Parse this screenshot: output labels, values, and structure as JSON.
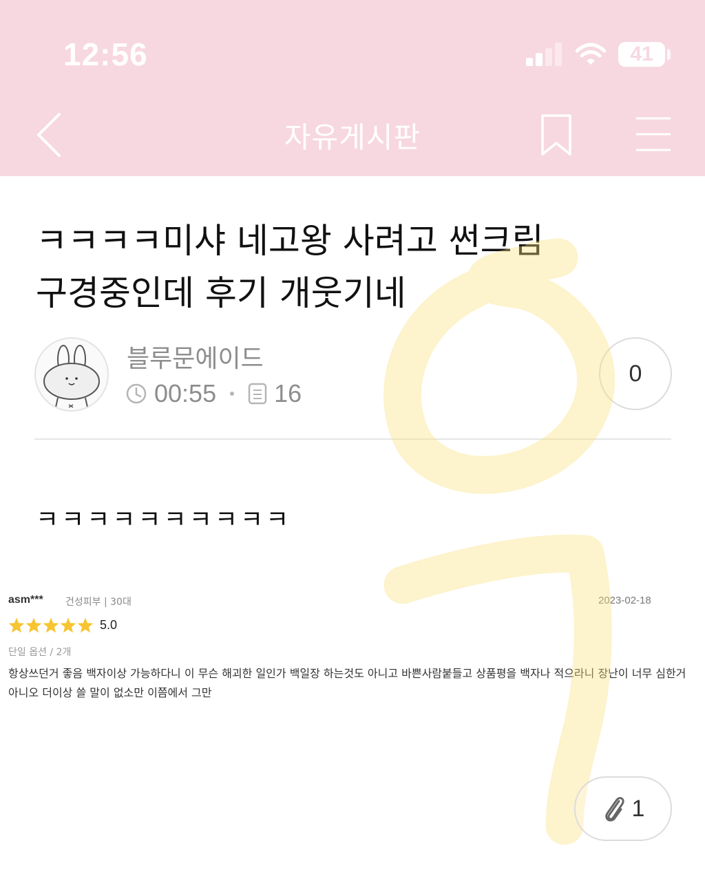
{
  "status_bar": {
    "time": "12:56",
    "battery": "41"
  },
  "nav": {
    "title": "자유게시판"
  },
  "post": {
    "title": "ㅋㅋㅋㅋ미샤 네고왕 사려고 썬크림 구경중인데 후기 개웃기네",
    "author": "블루문에이드",
    "time": "00:55",
    "views": "16",
    "likes": "0",
    "body": "ㅋㅋㅋㅋㅋㅋㅋㅋㅋㅋ"
  },
  "review": {
    "user": "asm***",
    "skin": "건성피부 | 30대",
    "date": "2023-02-18",
    "rating": "5.0",
    "stars": 5,
    "option": "단일 옵션 / 2개",
    "text": "항상쓰던거 좋음 백자이상 가능하다니 이 무슨 해괴한 일인가 백일장 하는것도 아니고 바쁜사람붙들고 상품평을 백자나 적으라니 장난이 너무 심한거 아니오 더이상 쓸 말이 없소만 이쯤에서 그만"
  },
  "attachment": {
    "count": "1"
  },
  "colors": {
    "header": "#f7d8e0",
    "highlighter": "#f9df7a",
    "star": "#f7c531"
  },
  "icons": [
    "signal-icon",
    "wifi-icon",
    "battery-icon",
    "back-arrow-icon",
    "bookmark-icon",
    "menu-icon",
    "clock-icon",
    "document-icon",
    "star-icon",
    "paperclip-icon",
    "bunny-avatar"
  ]
}
